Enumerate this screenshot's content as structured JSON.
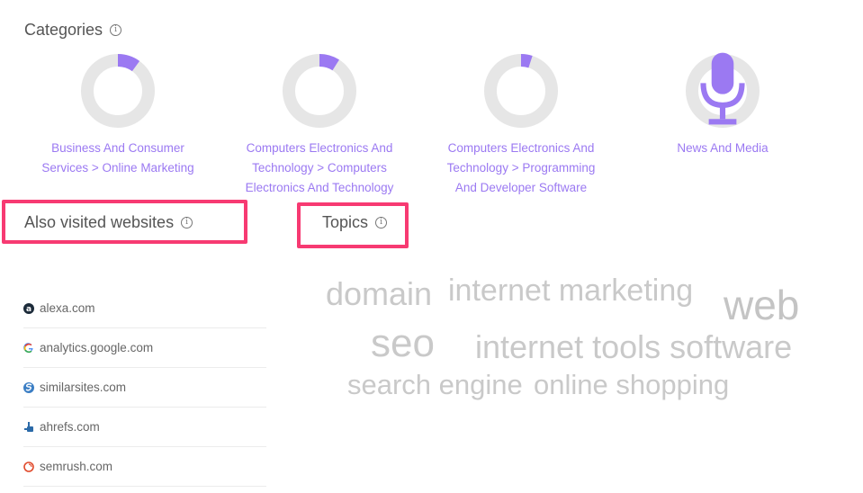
{
  "categories": {
    "title": "Categories",
    "info_icon": "info-icon",
    "accent_color": "#9b79f2",
    "track_color": "#e6e6e6",
    "items": [
      {
        "label_lines": [
          "Business And Consumer",
          "Services > Online Marketing"
        ],
        "share": 0.1,
        "icon": null
      },
      {
        "label_lines": [
          "Computers Electronics And",
          "Technology > Computers",
          "Electronics And Technology"
        ],
        "share": 0.09,
        "icon": null
      },
      {
        "label_lines": [
          "Computers Electronics And",
          "Technology > Programming",
          "And Developer Software"
        ],
        "share": 0.05,
        "icon": null
      },
      {
        "label_lines": [
          "News And Media"
        ],
        "share": 0.02,
        "icon": "microphone-icon"
      }
    ]
  },
  "also_visited": {
    "title": "Also visited websites",
    "info_icon": "info-icon",
    "highlight_color": "#f73a72",
    "sites": [
      {
        "domain": "alexa.com",
        "icon": "alexa-icon"
      },
      {
        "domain": "analytics.google.com",
        "icon": "google-icon"
      },
      {
        "domain": "similarsites.com",
        "icon": "similarsites-icon"
      },
      {
        "domain": "ahrefs.com",
        "icon": "ahrefs-icon"
      },
      {
        "domain": "semrush.com",
        "icon": "semrush-icon"
      }
    ]
  },
  "topics": {
    "title": "Topics",
    "info_icon": "info-icon",
    "highlight_color": "#f73a72",
    "words": [
      "domain",
      "internet marketing",
      "web",
      "seo",
      "internet tools software",
      "search engine",
      "online shopping"
    ]
  }
}
